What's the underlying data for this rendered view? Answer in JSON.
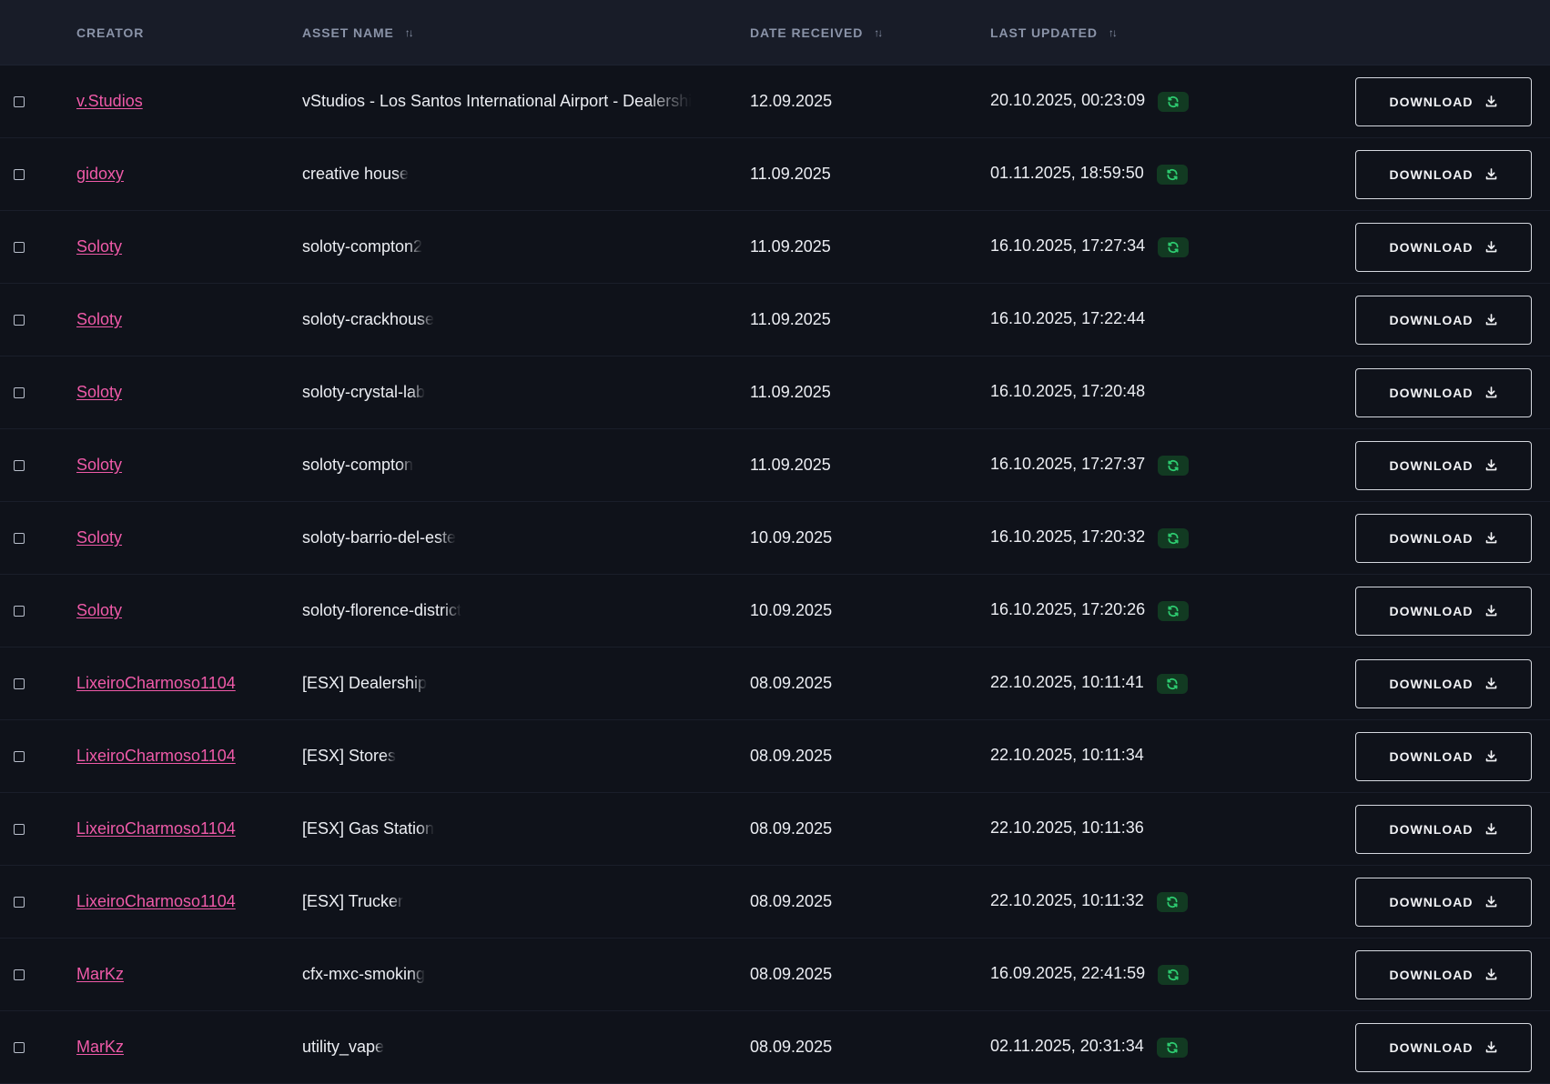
{
  "table": {
    "headers": {
      "creator": "CREATOR",
      "asset_name": "ASSET NAME",
      "date_received": "DATE RECEIVED",
      "last_updated": "LAST UPDATED"
    },
    "icons": {
      "sort": "sort-arrows-icon",
      "sync": "refresh-icon",
      "download": "download-icon"
    },
    "colors": {
      "creator_link": "#ef5aa8",
      "sync_badge_bg": "#123a22",
      "sync_icon": "#2ecc71"
    },
    "download_label": "DOWNLOAD",
    "rows": [
      {
        "creator": "v.Studios",
        "asset": "vStudios - Los Santos International Airport - Dealership",
        "date": "12.09.2025",
        "updated": "20.10.2025, 00:23:09",
        "synced": true
      },
      {
        "creator": "gidoxy",
        "asset": "creative house",
        "date": "11.09.2025",
        "updated": "01.11.2025, 18:59:50",
        "synced": true
      },
      {
        "creator": "Soloty",
        "asset": "soloty-compton2",
        "date": "11.09.2025",
        "updated": "16.10.2025, 17:27:34",
        "synced": true
      },
      {
        "creator": "Soloty",
        "asset": "soloty-crackhouse",
        "date": "11.09.2025",
        "updated": "16.10.2025, 17:22:44",
        "synced": false
      },
      {
        "creator": "Soloty",
        "asset": "soloty-crystal-lab",
        "date": "11.09.2025",
        "updated": "16.10.2025, 17:20:48",
        "synced": false
      },
      {
        "creator": "Soloty",
        "asset": "soloty-compton",
        "date": "11.09.2025",
        "updated": "16.10.2025, 17:27:37",
        "synced": true
      },
      {
        "creator": "Soloty",
        "asset": "soloty-barrio-del-este",
        "date": "10.09.2025",
        "updated": "16.10.2025, 17:20:32",
        "synced": true
      },
      {
        "creator": "Soloty",
        "asset": "soloty-florence-district",
        "date": "10.09.2025",
        "updated": "16.10.2025, 17:20:26",
        "synced": true
      },
      {
        "creator": "LixeiroCharmoso1104",
        "asset": "[ESX] Dealership",
        "date": "08.09.2025",
        "updated": "22.10.2025, 10:11:41",
        "synced": true
      },
      {
        "creator": "LixeiroCharmoso1104",
        "asset": "[ESX] Stores",
        "date": "08.09.2025",
        "updated": "22.10.2025, 10:11:34",
        "synced": false
      },
      {
        "creator": "LixeiroCharmoso1104",
        "asset": "[ESX] Gas Station",
        "date": "08.09.2025",
        "updated": "22.10.2025, 10:11:36",
        "synced": false
      },
      {
        "creator": "LixeiroCharmoso1104",
        "asset": "[ESX] Trucker",
        "date": "08.09.2025",
        "updated": "22.10.2025, 10:11:32",
        "synced": true
      },
      {
        "creator": "MarKz",
        "asset": "cfx-mxc-smoking",
        "date": "08.09.2025",
        "updated": "16.09.2025, 22:41:59",
        "synced": true
      },
      {
        "creator": "MarKz",
        "asset": "utility_vape",
        "date": "08.09.2025",
        "updated": "02.11.2025, 20:31:34",
        "synced": true
      }
    ]
  }
}
